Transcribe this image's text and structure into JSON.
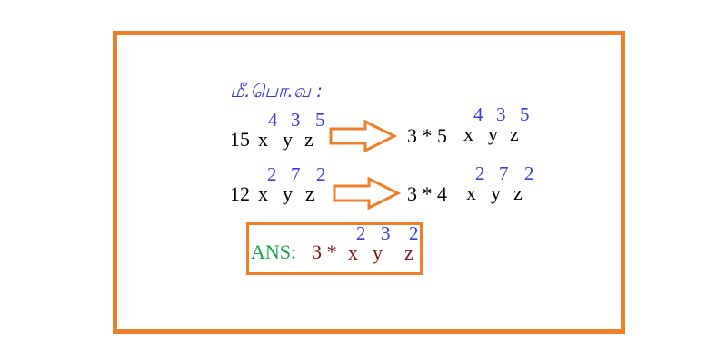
{
  "heading": "மீ.பொ.வ :",
  "row1": {
    "left": {
      "coef": "15",
      "x": "x",
      "y": "y",
      "z": "z",
      "ex": "4",
      "ey": "3",
      "ez": "5"
    },
    "right": {
      "coef": "3 * 5",
      "x": "x",
      "y": "y",
      "z": "z",
      "ex": "4",
      "ey": "3",
      "ez": "5"
    }
  },
  "row2": {
    "left": {
      "coef": "12",
      "x": "x",
      "y": "y",
      "z": "z",
      "ex": "2",
      "ey": "7",
      "ez": "2"
    },
    "right": {
      "coef": "3 * 4",
      "x": "x",
      "y": "y",
      "z": "z",
      "ex": "2",
      "ey": "7",
      "ez": "2"
    }
  },
  "answer": {
    "label": "ANS:",
    "coef": "3 *",
    "x": "x",
    "y": "y",
    "z": "z",
    "ex": "2",
    "ey": "3",
    "ez": "2"
  },
  "colors": {
    "frame": "#f07f2a",
    "exponent": "#3b3bd8",
    "answer_label": "#19a44b",
    "answer_value": "#7a1414"
  }
}
